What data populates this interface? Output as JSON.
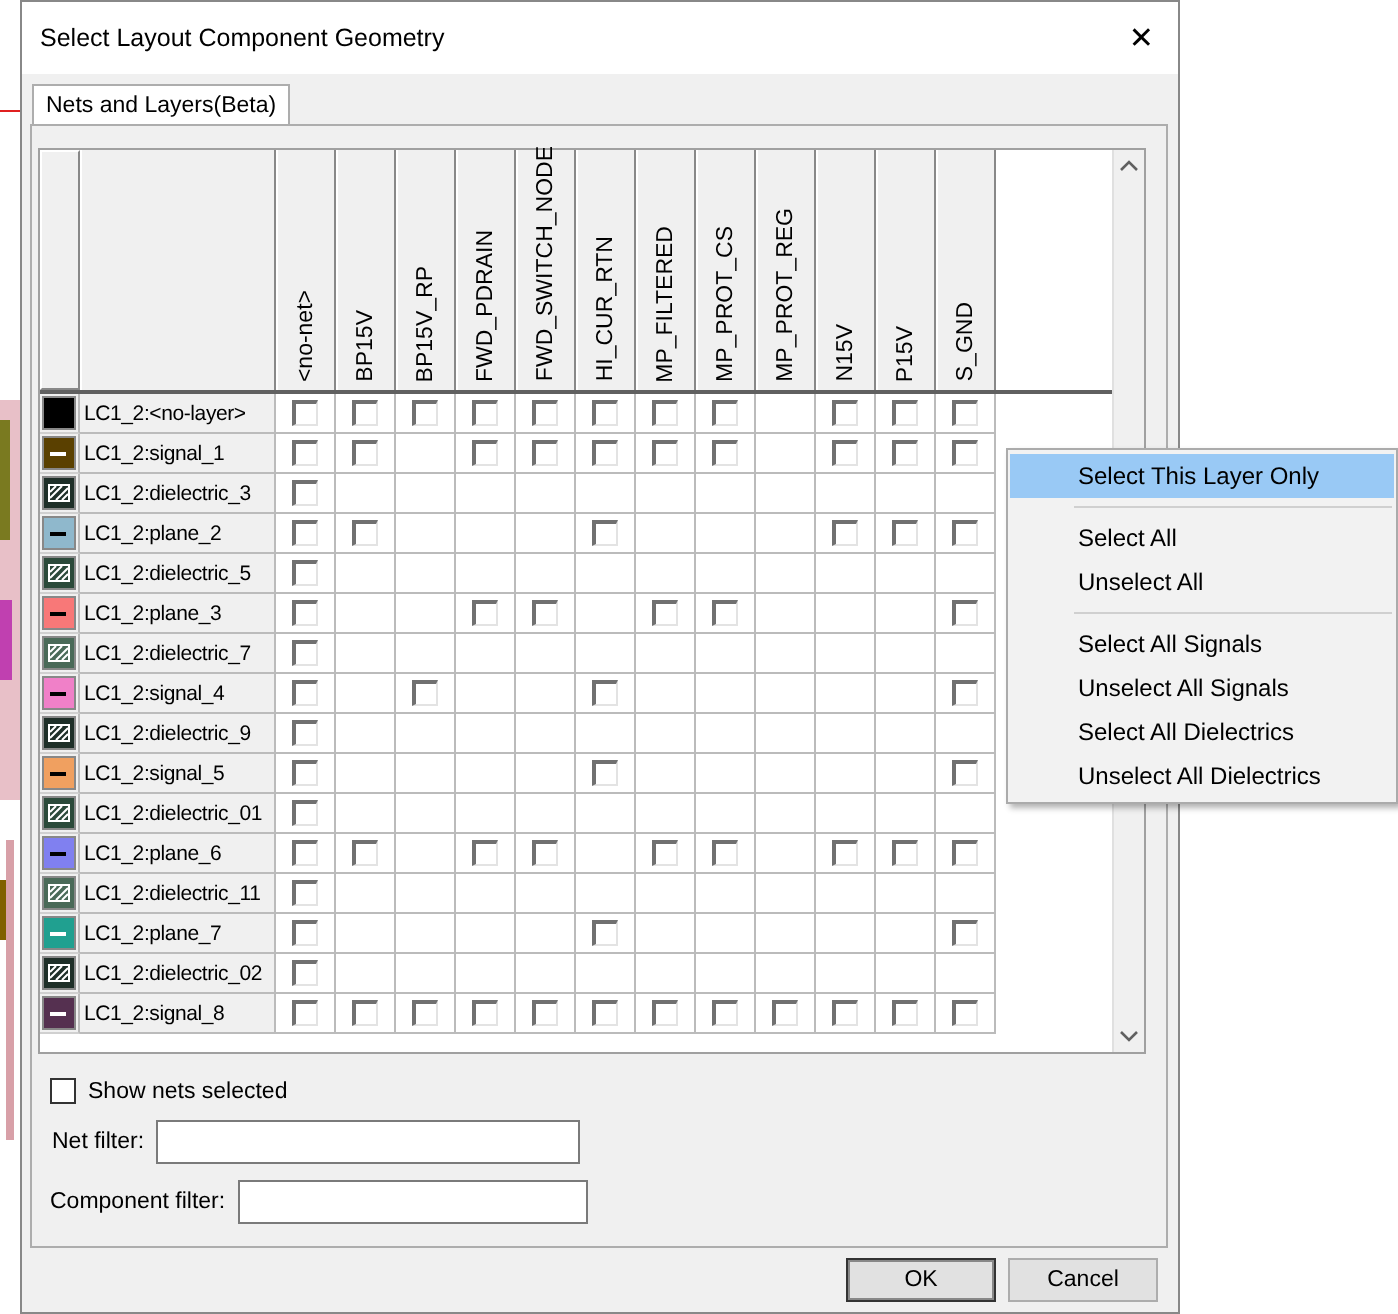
{
  "window": {
    "title": "Select Layout Component Geometry",
    "close": "✕"
  },
  "tabs": [
    {
      "label": "Nets and Layers(Beta)",
      "selected": true
    }
  ],
  "grid": {
    "columns": [
      "<no-net>",
      "BP15V",
      "BP15V_RP",
      "FWD_PDRAIN",
      "FWD_SWITCH_NODE",
      "HI_CUR_RTN",
      "MP_FILTERED",
      "MP_PROT_CS",
      "MP_PROT_REG",
      "N15V",
      "P15V",
      "S_GND"
    ],
    "rows": [
      {
        "name": "LC1_2:<no-layer>",
        "kind": "solid",
        "color": "#000000",
        "cells": [
          {
            "kind": "checkbox",
            "checked": false
          },
          {
            "kind": "checkbox",
            "checked": false
          },
          {
            "kind": "checkbox",
            "checked": false
          },
          {
            "kind": "checkbox",
            "checked": false
          },
          {
            "kind": "checkbox",
            "checked": false
          },
          {
            "kind": "checkbox",
            "checked": false
          },
          {
            "kind": "checkbox",
            "checked": false
          },
          {
            "kind": "checkbox",
            "checked": false
          },
          {
            "kind": "empty"
          },
          {
            "kind": "checkbox",
            "checked": false
          },
          {
            "kind": "checkbox",
            "checked": false
          },
          {
            "kind": "checkbox",
            "checked": false
          }
        ]
      },
      {
        "name": "LC1_2:signal_1",
        "kind": "line",
        "color": "#5a4000",
        "cells": [
          {
            "kind": "checkbox",
            "checked": false
          },
          {
            "kind": "checkbox",
            "checked": false
          },
          {
            "kind": "empty"
          },
          {
            "kind": "checkbox",
            "checked": false
          },
          {
            "kind": "checkbox",
            "checked": false
          },
          {
            "kind": "checkbox",
            "checked": false
          },
          {
            "kind": "checkbox",
            "checked": false
          },
          {
            "kind": "checkbox",
            "checked": false
          },
          {
            "kind": "empty"
          },
          {
            "kind": "checkbox",
            "checked": false
          },
          {
            "kind": "checkbox",
            "checked": false
          },
          {
            "kind": "checkbox",
            "checked": false
          }
        ]
      },
      {
        "name": "LC1_2:dielectric_3",
        "kind": "hatched",
        "color": "#1e2f28",
        "cells": [
          {
            "kind": "checkbox",
            "checked": false
          },
          {
            "kind": "empty"
          },
          {
            "kind": "empty"
          },
          {
            "kind": "empty"
          },
          {
            "kind": "empty"
          },
          {
            "kind": "empty"
          },
          {
            "kind": "empty"
          },
          {
            "kind": "empty"
          },
          {
            "kind": "empty"
          },
          {
            "kind": "empty"
          },
          {
            "kind": "empty"
          },
          {
            "kind": "empty"
          }
        ]
      },
      {
        "name": "LC1_2:plane_2",
        "kind": "line",
        "color": "#8fb8cc",
        "cells": [
          {
            "kind": "checkbox",
            "checked": false
          },
          {
            "kind": "checkbox",
            "checked": false
          },
          {
            "kind": "empty"
          },
          {
            "kind": "empty"
          },
          {
            "kind": "empty"
          },
          {
            "kind": "checkbox",
            "checked": false
          },
          {
            "kind": "empty"
          },
          {
            "kind": "empty"
          },
          {
            "kind": "empty"
          },
          {
            "kind": "checkbox",
            "checked": false
          },
          {
            "kind": "checkbox",
            "checked": false
          },
          {
            "kind": "checkbox",
            "checked": false
          }
        ]
      },
      {
        "name": "LC1_2:dielectric_5",
        "kind": "hatched",
        "color": "#2b4a3a",
        "cells": [
          {
            "kind": "checkbox",
            "checked": false
          },
          {
            "kind": "empty"
          },
          {
            "kind": "empty"
          },
          {
            "kind": "empty"
          },
          {
            "kind": "empty"
          },
          {
            "kind": "empty"
          },
          {
            "kind": "empty"
          },
          {
            "kind": "empty"
          },
          {
            "kind": "empty"
          },
          {
            "kind": "empty"
          },
          {
            "kind": "empty"
          },
          {
            "kind": "empty"
          }
        ]
      },
      {
        "name": "LC1_2:plane_3",
        "kind": "line",
        "color": "#f87878",
        "cells": [
          {
            "kind": "checkbox",
            "checked": false
          },
          {
            "kind": "empty"
          },
          {
            "kind": "empty"
          },
          {
            "kind": "checkbox",
            "checked": false
          },
          {
            "kind": "checkbox",
            "checked": false
          },
          {
            "kind": "empty"
          },
          {
            "kind": "checkbox",
            "checked": false
          },
          {
            "kind": "checkbox",
            "checked": false
          },
          {
            "kind": "empty"
          },
          {
            "kind": "empty"
          },
          {
            "kind": "empty"
          },
          {
            "kind": "checkbox",
            "checked": false
          }
        ]
      },
      {
        "name": "LC1_2:dielectric_7",
        "kind": "hatched",
        "color": "#4a6a58",
        "cells": [
          {
            "kind": "checkbox",
            "checked": false
          },
          {
            "kind": "empty"
          },
          {
            "kind": "empty"
          },
          {
            "kind": "empty"
          },
          {
            "kind": "empty"
          },
          {
            "kind": "empty"
          },
          {
            "kind": "empty"
          },
          {
            "kind": "empty"
          },
          {
            "kind": "empty"
          },
          {
            "kind": "empty"
          },
          {
            "kind": "empty"
          },
          {
            "kind": "empty"
          }
        ]
      },
      {
        "name": "LC1_2:signal_4",
        "kind": "line",
        "color": "#f080c8",
        "cells": [
          {
            "kind": "checkbox",
            "checked": false
          },
          {
            "kind": "empty"
          },
          {
            "kind": "checkbox",
            "checked": false
          },
          {
            "kind": "empty"
          },
          {
            "kind": "empty"
          },
          {
            "kind": "checkbox",
            "checked": false
          },
          {
            "kind": "empty"
          },
          {
            "kind": "empty"
          },
          {
            "kind": "empty"
          },
          {
            "kind": "empty"
          },
          {
            "kind": "empty"
          },
          {
            "kind": "checkbox",
            "checked": false
          }
        ]
      },
      {
        "name": "LC1_2:dielectric_9",
        "kind": "hatched",
        "color": "#1e2f28",
        "cells": [
          {
            "kind": "checkbox",
            "checked": false
          },
          {
            "kind": "empty"
          },
          {
            "kind": "empty"
          },
          {
            "kind": "empty"
          },
          {
            "kind": "empty"
          },
          {
            "kind": "empty"
          },
          {
            "kind": "empty"
          },
          {
            "kind": "empty"
          },
          {
            "kind": "empty"
          },
          {
            "kind": "empty"
          },
          {
            "kind": "empty"
          },
          {
            "kind": "empty"
          }
        ]
      },
      {
        "name": "LC1_2:signal_5",
        "kind": "line",
        "color": "#f0a060",
        "cells": [
          {
            "kind": "checkbox",
            "checked": false
          },
          {
            "kind": "empty"
          },
          {
            "kind": "empty"
          },
          {
            "kind": "empty"
          },
          {
            "kind": "empty"
          },
          {
            "kind": "checkbox",
            "checked": false
          },
          {
            "kind": "empty"
          },
          {
            "kind": "empty"
          },
          {
            "kind": "empty"
          },
          {
            "kind": "empty"
          },
          {
            "kind": "empty"
          },
          {
            "kind": "checkbox",
            "checked": false
          }
        ]
      },
      {
        "name": "LC1_2:dielectric_01",
        "kind": "hatched",
        "color": "#2b4a3a",
        "cells": [
          {
            "kind": "checkbox",
            "checked": false
          },
          {
            "kind": "empty"
          },
          {
            "kind": "empty"
          },
          {
            "kind": "empty"
          },
          {
            "kind": "empty"
          },
          {
            "kind": "empty"
          },
          {
            "kind": "empty"
          },
          {
            "kind": "empty"
          },
          {
            "kind": "empty"
          },
          {
            "kind": "empty"
          },
          {
            "kind": "empty"
          },
          {
            "kind": "empty"
          }
        ]
      },
      {
        "name": "LC1_2:plane_6",
        "kind": "line",
        "color": "#8080f0",
        "cells": [
          {
            "kind": "checkbox",
            "checked": false
          },
          {
            "kind": "checkbox",
            "checked": false
          },
          {
            "kind": "empty"
          },
          {
            "kind": "checkbox",
            "checked": false
          },
          {
            "kind": "checkbox",
            "checked": false
          },
          {
            "kind": "empty"
          },
          {
            "kind": "checkbox",
            "checked": false
          },
          {
            "kind": "checkbox",
            "checked": false
          },
          {
            "kind": "empty"
          },
          {
            "kind": "checkbox",
            "checked": false
          },
          {
            "kind": "checkbox",
            "checked": false
          },
          {
            "kind": "checkbox",
            "checked": false
          }
        ]
      },
      {
        "name": "LC1_2:dielectric_11",
        "kind": "hatched",
        "color": "#4a6a58",
        "cells": [
          {
            "kind": "checkbox",
            "checked": false
          },
          {
            "kind": "empty"
          },
          {
            "kind": "empty"
          },
          {
            "kind": "empty"
          },
          {
            "kind": "empty"
          },
          {
            "kind": "empty"
          },
          {
            "kind": "empty"
          },
          {
            "kind": "empty"
          },
          {
            "kind": "empty"
          },
          {
            "kind": "empty"
          },
          {
            "kind": "empty"
          },
          {
            "kind": "empty"
          }
        ]
      },
      {
        "name": "LC1_2:plane_7",
        "kind": "line",
        "color": "#20a090",
        "cells": [
          {
            "kind": "checkbox",
            "checked": false
          },
          {
            "kind": "empty"
          },
          {
            "kind": "empty"
          },
          {
            "kind": "empty"
          },
          {
            "kind": "empty"
          },
          {
            "kind": "checkbox",
            "checked": false
          },
          {
            "kind": "empty"
          },
          {
            "kind": "empty"
          },
          {
            "kind": "empty"
          },
          {
            "kind": "empty"
          },
          {
            "kind": "empty"
          },
          {
            "kind": "checkbox",
            "checked": false
          }
        ]
      },
      {
        "name": "LC1_2:dielectric_02",
        "kind": "hatched",
        "color": "#1e2f28",
        "cells": [
          {
            "kind": "checkbox",
            "checked": false
          },
          {
            "kind": "empty"
          },
          {
            "kind": "empty"
          },
          {
            "kind": "empty"
          },
          {
            "kind": "empty"
          },
          {
            "kind": "empty"
          },
          {
            "kind": "empty"
          },
          {
            "kind": "empty"
          },
          {
            "kind": "empty"
          },
          {
            "kind": "empty"
          },
          {
            "kind": "empty"
          },
          {
            "kind": "empty"
          }
        ]
      },
      {
        "name": "LC1_2:signal_8",
        "kind": "line",
        "color": "#553050",
        "cells": [
          {
            "kind": "checkbox",
            "checked": false
          },
          {
            "kind": "checkbox",
            "checked": false
          },
          {
            "kind": "checkbox",
            "checked": false
          },
          {
            "kind": "checkbox",
            "checked": false
          },
          {
            "kind": "checkbox",
            "checked": false
          },
          {
            "kind": "checkbox",
            "checked": false
          },
          {
            "kind": "checkbox",
            "checked": false
          },
          {
            "kind": "checkbox",
            "checked": false
          },
          {
            "kind": "checkbox",
            "checked": false
          },
          {
            "kind": "checkbox",
            "checked": false
          },
          {
            "kind": "checkbox",
            "checked": false
          },
          {
            "kind": "checkbox",
            "checked": false
          }
        ]
      }
    ]
  },
  "show_nets_selected": {
    "label": "Show nets selected",
    "checked": false
  },
  "filters": [
    {
      "label": "Net filter:"
    },
    {
      "label": "Component filter:"
    }
  ],
  "buttons": [
    "OK",
    "Cancel"
  ],
  "context_menu": {
    "groups": [
      [
        {
          "label": "Select This Layer Only",
          "selected": true
        }
      ],
      [
        {
          "label": "Select All",
          "selected": false
        },
        {
          "label": "Unselect All",
          "selected": false
        }
      ],
      [
        {
          "label": "Select All Signals",
          "selected": false
        },
        {
          "label": "Unselect All Signals",
          "selected": false
        },
        {
          "label": "Select All Dielectrics",
          "selected": false
        },
        {
          "label": "Unselect All Dielectrics",
          "selected": false
        }
      ]
    ]
  }
}
